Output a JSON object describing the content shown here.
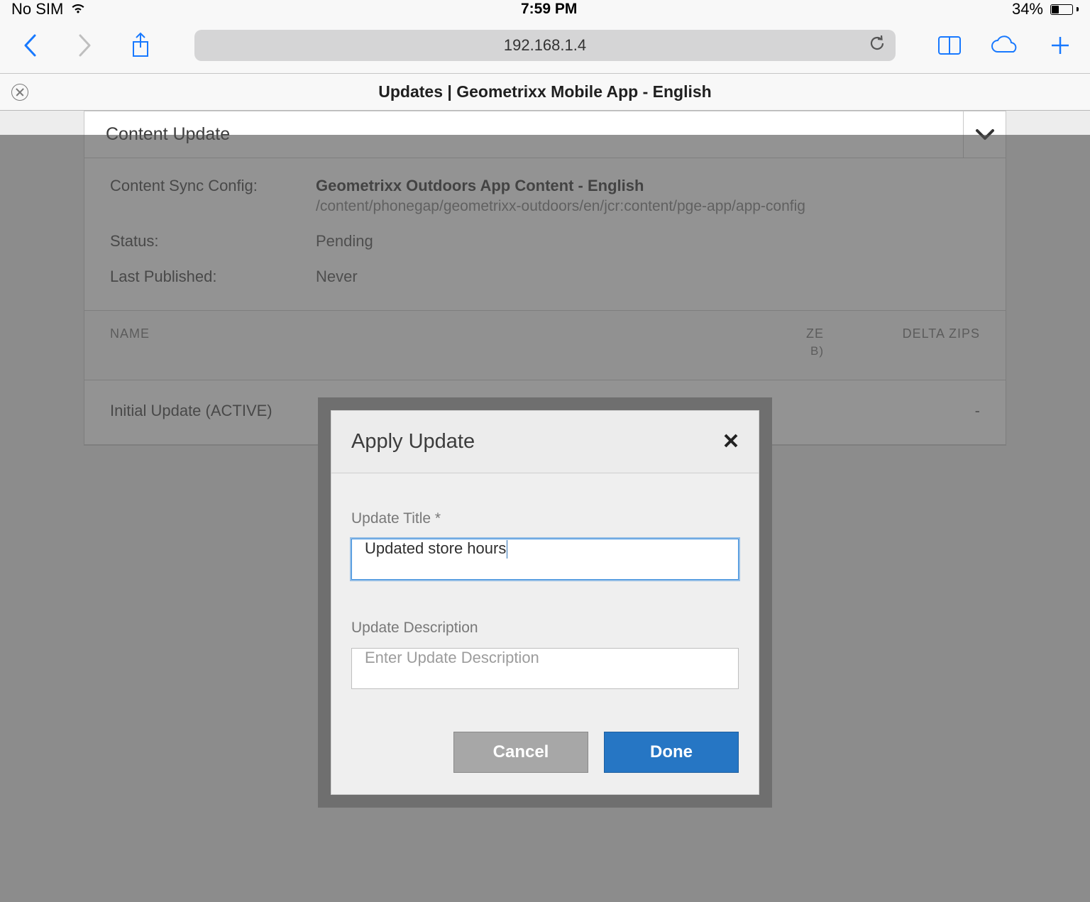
{
  "statusbar": {
    "carrier": "No SIM",
    "time": "7:59 PM",
    "battery_pct": "34%"
  },
  "toolbar": {
    "url": "192.168.1.4"
  },
  "page": {
    "title": "Updates | Geometrixx Mobile App - English"
  },
  "panel": {
    "title": "Content Update",
    "config_label": "Content Sync Config:",
    "config_name": "Geometrixx Outdoors App Content - English",
    "config_path": "/content/phonegap/geometrixx-outdoors/en/jcr:content/pge-app/app-config",
    "status_label": "Status:",
    "status_value": "Pending",
    "lastpub_label": "Last Published:",
    "lastpub_value": "Never",
    "table": {
      "col1": "NAME",
      "col2": "ZE",
      "col2_sub": "B)",
      "col3": "DELTA ZIPS",
      "row1_name": "Initial Update (ACTIVE)",
      "row1_delta": "-"
    }
  },
  "modal": {
    "title": "Apply Update",
    "title_label": "Update Title *",
    "title_value": "Updated store hours",
    "desc_label": "Update Description",
    "desc_placeholder": "Enter Update Description",
    "cancel": "Cancel",
    "done": "Done"
  }
}
